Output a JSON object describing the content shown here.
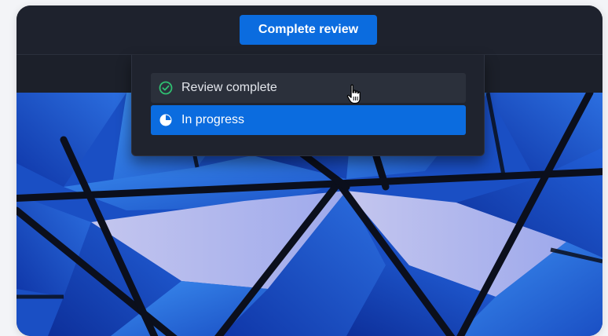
{
  "toolbar": {
    "primary_button_label": "Complete review"
  },
  "status_menu": {
    "items": [
      {
        "label": "Review complete",
        "icon": "check-circle-icon",
        "selected": false
      },
      {
        "label": "In progress",
        "icon": "half-circle-icon",
        "selected": true
      }
    ]
  },
  "colors": {
    "accent": "#0b6cdf",
    "success": "#2fbf71",
    "panel": "#1f232e"
  }
}
